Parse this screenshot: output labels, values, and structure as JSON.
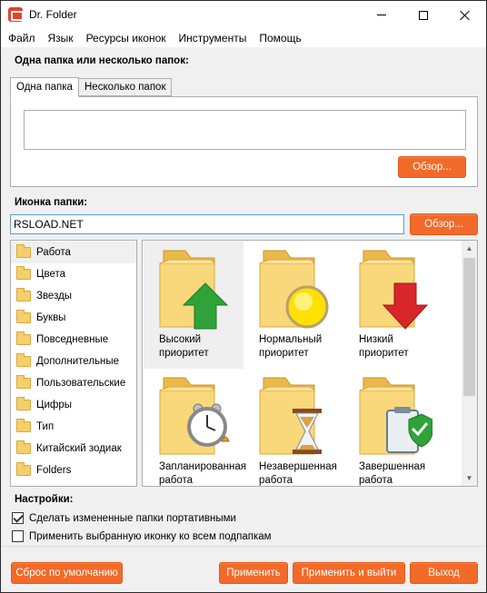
{
  "window": {
    "title": "Dr. Folder"
  },
  "menu": {
    "items": [
      "Файл",
      "Язык",
      "Ресурсы иконок",
      "Инструменты",
      "Помощь"
    ]
  },
  "folder_section": {
    "label": "Одна папка или несколько папок:",
    "tabs": [
      "Одна папка",
      "Несколько папок"
    ],
    "active_tab": "Одна папка",
    "path_value": "",
    "browse_label": "Обзор..."
  },
  "icon_section": {
    "label": "Иконка папки:",
    "input_value": "RSLOAD.NET",
    "browse_label": "Обзор..."
  },
  "categories": {
    "items": [
      "Работа",
      "Цвета",
      "Звезды",
      "Буквы",
      "Повседневные",
      "Дополнительные",
      "Пользовательские",
      "Цифры",
      "Тип",
      "Китайский зодиак",
      "Folders"
    ],
    "selected": "Работа"
  },
  "icons": {
    "items": [
      {
        "line1": "Высокий",
        "line2": "приоритет",
        "icon": "folder-green-up-arrow-icon"
      },
      {
        "line1": "Нормальный",
        "line2": "приоритет",
        "icon": "folder-yellow-circle-icon"
      },
      {
        "line1": "Низкий",
        "line2": "приоритет",
        "icon": "folder-red-down-arrow-icon"
      },
      {
        "line1": "Запланированная",
        "line2": "работа",
        "icon": "folder-alarm-clock-icon"
      },
      {
        "line1": "Незавершенная",
        "line2": "работа",
        "icon": "folder-hourglass-icon"
      },
      {
        "line1": "Завершенная",
        "line2": "работа",
        "icon": "folder-clipboard-check-icon"
      }
    ],
    "selected_index": 0
  },
  "settings": {
    "label": "Настройки:",
    "portable_label": "Сделать измененные папки портативными",
    "portable_checked": true,
    "apply_sub_label": "Применить выбранную иконку ко всем подпапкам",
    "apply_sub_checked": false
  },
  "footer": {
    "reset_label": "Сброс по умолчанию",
    "apply_label": "Применить",
    "apply_exit_label": "Применить и выйти",
    "exit_label": "Выход"
  },
  "colors": {
    "accent": "#f26a29",
    "folder": "#f5cf6b"
  }
}
